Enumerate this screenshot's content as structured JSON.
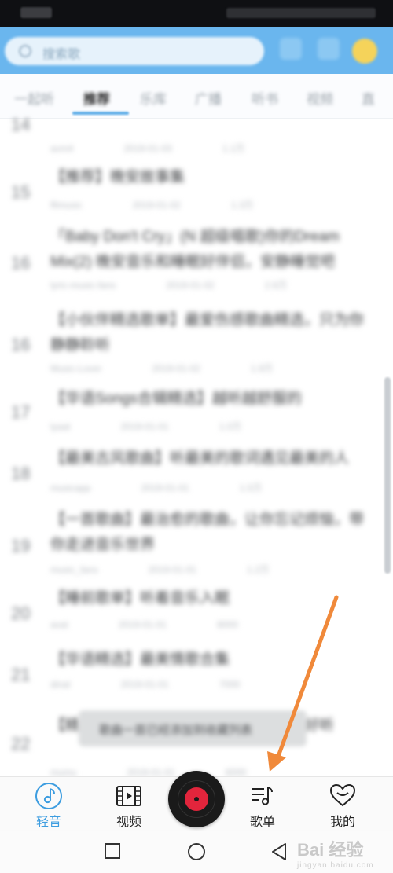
{
  "header": {
    "search_placeholder": "搜索歌"
  },
  "tabs": [
    {
      "label": "一起听"
    },
    {
      "label": "推荐"
    },
    {
      "label": "乐库"
    },
    {
      "label": "广播"
    },
    {
      "label": "听书"
    },
    {
      "label": "视频"
    },
    {
      "label": "直"
    }
  ],
  "list": {
    "items": [
      {
        "num": "14",
        "title": "",
        "meta": [
          "avm4",
          "2019-01-03",
          "1.1万"
        ]
      },
      {
        "num": "15",
        "title": "【推荐】晚安故事集",
        "meta": [
          "ffimusic",
          "2019-01-02",
          "1.3万"
        ]
      },
      {
        "num": "16",
        "title": "「Baby Don't Cry」(N 超级唱歌)你的Dream Mix(2) 晚安音乐和睡眠好伴侣，安静睡觉吧",
        "meta": [
          "lyric-music-fans",
          "2019-01-02",
          "2.6万"
        ]
      },
      {
        "num": "16",
        "title": "【小伙伴精选歌单】最爱伤感歌曲精选，只为你静静聆听",
        "meta": [
          "Music-Lover",
          "2019-01-02",
          "1.9万"
        ]
      },
      {
        "num": "17",
        "title": "【华语Songs合辑精选】越听越舒服的",
        "meta": [
          "lyaat",
          "2019-01-01",
          "1.0万"
        ]
      },
      {
        "num": "18",
        "title": "【最美古风歌曲】听最美的歌词遇见最美的人",
        "meta": [
          "musicapp",
          "2019-01-01",
          "1.5万"
        ]
      },
      {
        "num": "19",
        "title": "【一首歌曲】最治愈的歌曲，让你忘记烦恼，带你走进音乐世界",
        "meta": [
          "music_fans",
          "2019-01-01",
          "1.2万"
        ]
      },
      {
        "num": "20",
        "title": "【睡前歌单】听着音乐入眠",
        "meta": [
          "avat",
          "2019-01-01",
          "8000"
        ]
      },
      {
        "num": "21",
        "title": "【华语精选】最美情歌合集",
        "meta": [
          "dinal",
          "2019-01-01",
          "7000"
        ]
      },
      {
        "num": "22",
        "title": "【精选歌单】经典老歌回味无穷，歌曲好听",
        "meta": [
          "mumu",
          "2019-01-01",
          "6000"
        ]
      }
    ]
  },
  "toast": {
    "text": "歌曲一首已经添加到收藏列表"
  },
  "tabbar": {
    "items": [
      {
        "label": "轻音",
        "icon": "music-note-icon",
        "active": true
      },
      {
        "label": "视频",
        "icon": "film-icon",
        "active": false
      },
      {
        "label": "歌单",
        "icon": "playlist-icon",
        "active": false
      },
      {
        "label": "我的",
        "icon": "heart-icon",
        "active": false
      }
    ]
  },
  "watermark": {
    "text": "Bai 经验",
    "sub": "jingyan.baidu.com"
  },
  "colors": {
    "accent": "#3d9de0",
    "header": "#6ab6ee",
    "record": "#e2253c",
    "annotation_arrow": "#f0893a"
  }
}
